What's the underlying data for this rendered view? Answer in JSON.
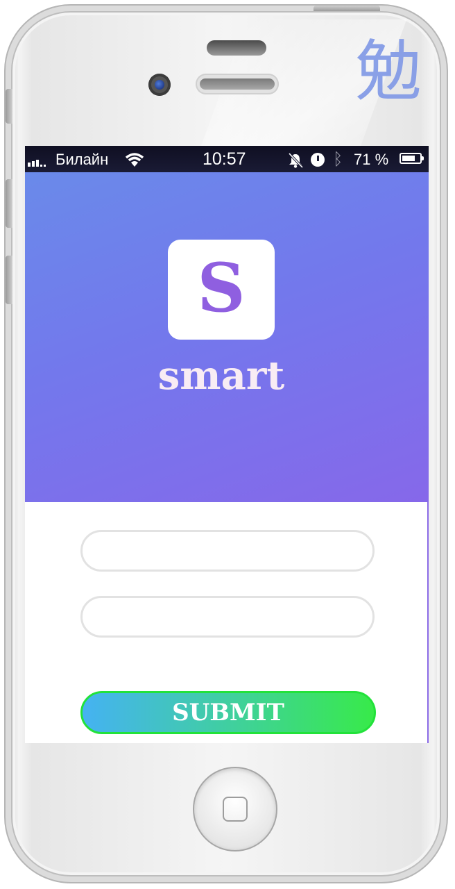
{
  "device": {
    "watermark_glyph": "勉"
  },
  "statusbar": {
    "carrier": "Билайн",
    "time": "10:57",
    "battery_percent": "71 %",
    "icons": [
      "signal-icon",
      "wifi-icon",
      "silent-bell-icon",
      "alarm-icon",
      "bluetooth-icon",
      "battery-icon"
    ]
  },
  "app": {
    "logo_letter": "S",
    "name": "smart"
  },
  "form": {
    "field1": {
      "value": "",
      "placeholder": ""
    },
    "field2": {
      "value": "",
      "placeholder": ""
    },
    "submit_label": "SUBMIT"
  },
  "colors": {
    "hero_gradient_start": "#6a8aea",
    "hero_gradient_end": "#8668ea",
    "logo_letter": "#8f5fe0",
    "submit_gradient_start": "#45b2f2",
    "submit_gradient_end": "#38ea4a",
    "submit_border": "#22e23a"
  }
}
